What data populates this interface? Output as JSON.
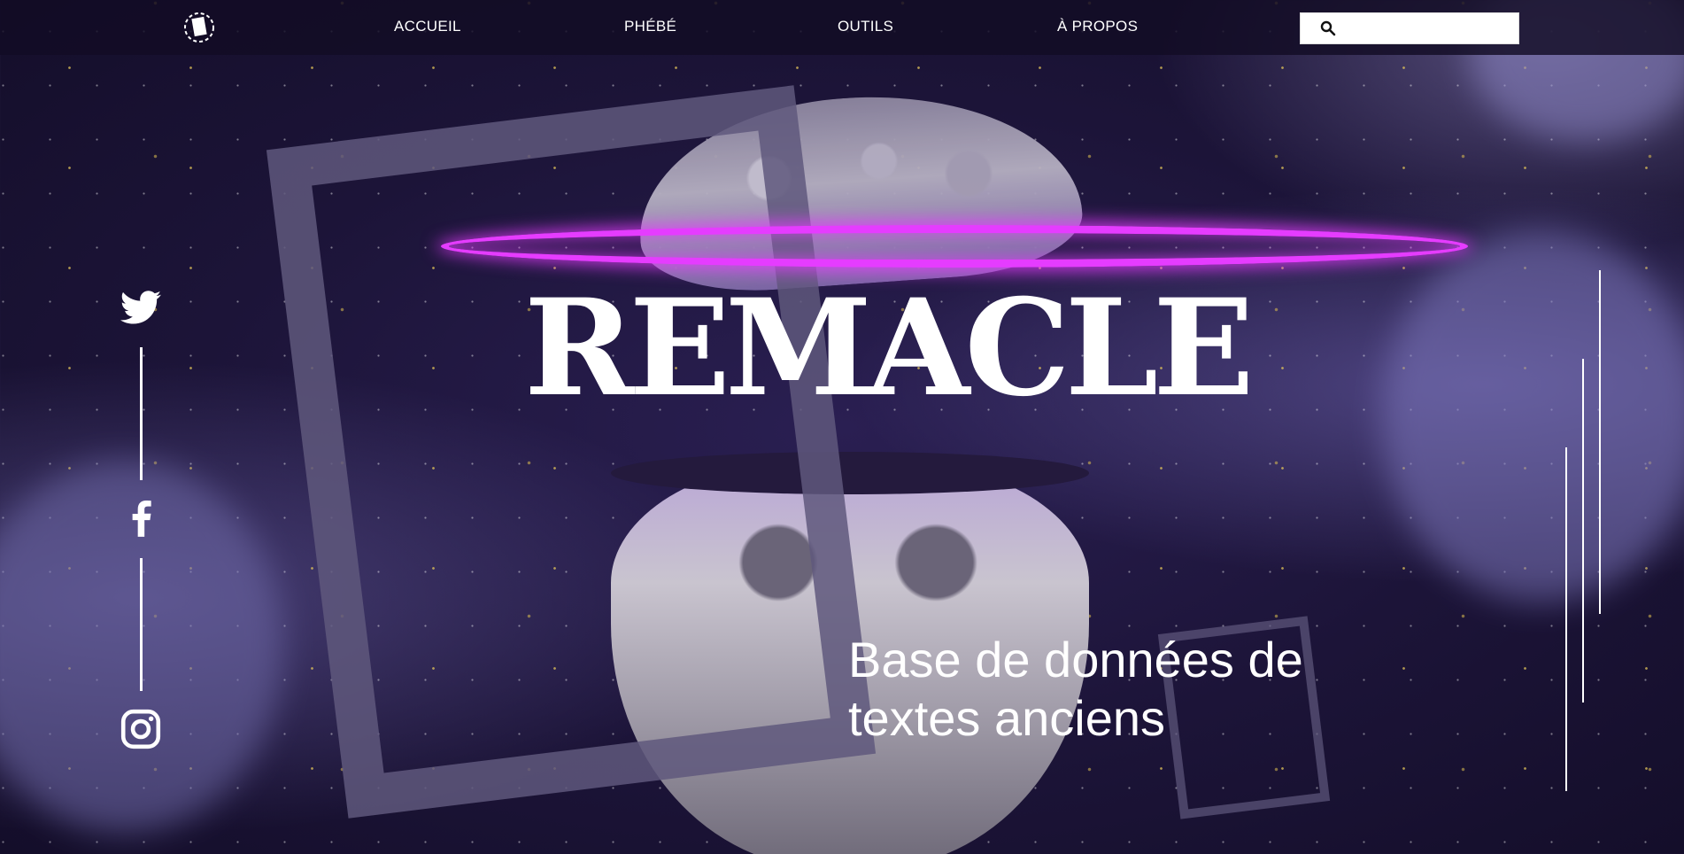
{
  "nav": {
    "links": [
      "ACCUEIL",
      "PHÉBÉ",
      "OUTILS",
      "À PROPOS"
    ],
    "search": {
      "placeholder": "",
      "value": ""
    }
  },
  "hero": {
    "title": "REMACLE",
    "subtitle": "Base de données de textes anciens"
  },
  "social": [
    "twitter-icon",
    "facebook-icon",
    "instagram-icon"
  ],
  "colors": {
    "background": "#1c1438",
    "halo": "#e53cff",
    "text": "#ffffff",
    "frame": "#5f587d"
  }
}
